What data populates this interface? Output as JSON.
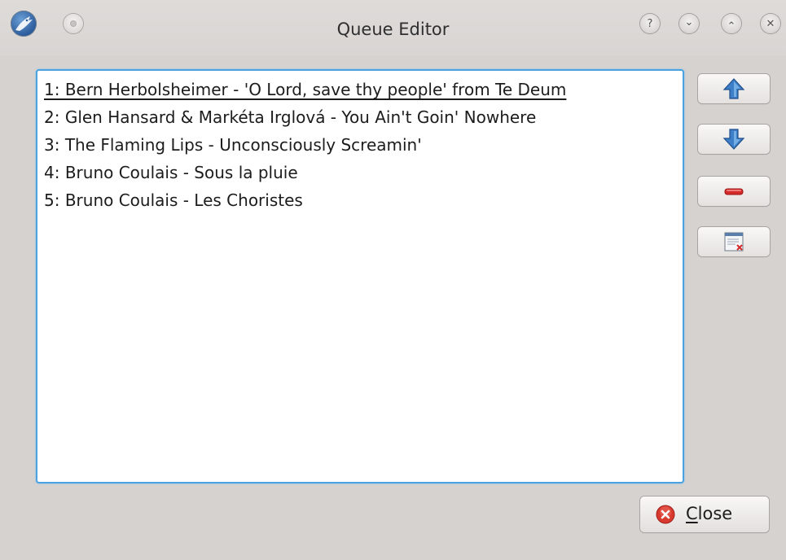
{
  "window": {
    "title": "Queue Editor"
  },
  "titlebar": {
    "app_icon": "amarok-wolf-icon",
    "on_all_desktops_icon": "on-all-desktops-icon",
    "help_icon": "help-icon",
    "help_glyph": "?",
    "minimize_icon": "minimize-icon",
    "minimize_glyph": "⌄",
    "maximize_icon": "maximize-icon",
    "maximize_glyph": "⌃",
    "close_icon": "close-icon",
    "close_glyph": "✕"
  },
  "queue": {
    "items": [
      {
        "label": "1: Bern Herbolsheimer - 'O Lord, save thy people' from Te Deum",
        "current": true
      },
      {
        "label": "2: Glen Hansard & Markéta Irglová - You Ain't Goin' Nowhere",
        "current": false
      },
      {
        "label": "3: The Flaming Lips - Unconsciously Screamin'",
        "current": false
      },
      {
        "label": "4: Bruno Coulais - Sous la pluie",
        "current": false
      },
      {
        "label": "5: Bruno Coulais - Les Choristes",
        "current": false
      }
    ]
  },
  "actions": {
    "move_up_icon": "arrow-up-icon",
    "move_down_icon": "arrow-down-icon",
    "remove_icon": "remove-icon",
    "clear_icon": "clear-queue-icon"
  },
  "footer": {
    "close_label_mnemonic": "C",
    "close_label_rest": "lose",
    "close_icon": "dialog-close-icon"
  },
  "colors": {
    "focus_border": "#4aa3e0",
    "arrow_blue": "#3c7fc8",
    "remove_red": "#d42a2a",
    "close_red": "#d93a2f"
  }
}
